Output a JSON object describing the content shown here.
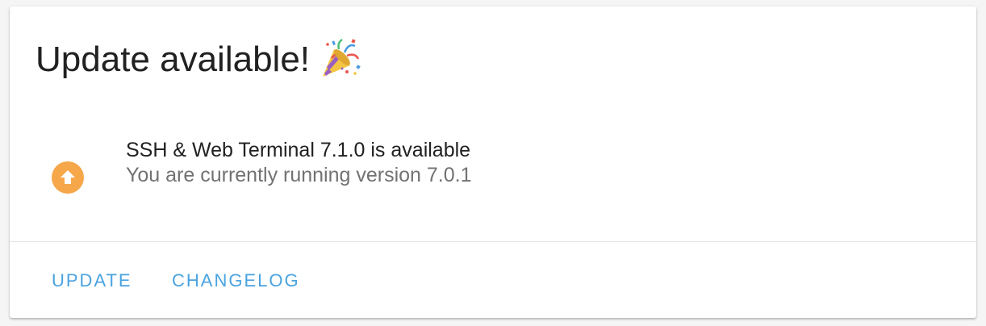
{
  "card": {
    "title": "Update available!",
    "title_icon": "party-popper-icon"
  },
  "update": {
    "icon": "arrow-up-circle-icon",
    "icon_color": "#f6a74a",
    "primary_text": "SSH & Web Terminal 7.1.0 is available",
    "secondary_text": "You are currently running version 7.0.1"
  },
  "actions": {
    "update_label": "UPDATE",
    "changelog_label": "CHANGELOG",
    "accent_color": "#4aa3e0"
  }
}
